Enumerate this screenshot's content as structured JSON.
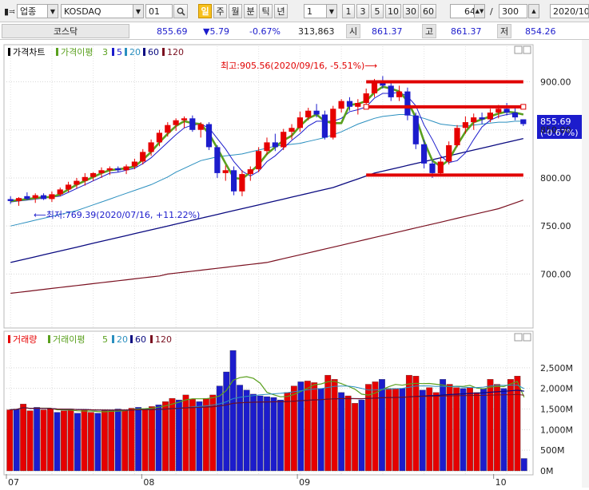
{
  "toolbar": {
    "category": "업종",
    "symbol": "KOSDAQ",
    "period_value": "01",
    "period_buttons": [
      "일",
      "주",
      "월",
      "분",
      "틱",
      "년"
    ],
    "active_period": "일",
    "minute_select": "1",
    "minute_buttons": [
      "1",
      "3",
      "5",
      "10",
      "30",
      "60"
    ],
    "count_value": "64",
    "count_separator": "/",
    "total_value": "300",
    "date_value": "2020/10/"
  },
  "info": {
    "name": "코스닥",
    "price": "855.69",
    "change": "▼5.79",
    "change_pct": "-0.67%",
    "volume": "313,863",
    "open_label": "시",
    "open": "861.37",
    "high_label": "고",
    "high": "861.37",
    "low_label": "저",
    "low": "854.26"
  },
  "colors": {
    "up": "#e60000",
    "down": "#1c1ccc",
    "ma3": "#5aa01e",
    "ma5": "#1c1ccc",
    "ma20": "#2a8fbf",
    "ma60": "#0a0a80",
    "ma120": "#7a1020",
    "highlight": "#e00000"
  },
  "price_panel": {
    "legend_title": "가격차트",
    "legend_ma_label": "가격이평",
    "legend_periods": [
      "3",
      "5",
      "20",
      "60",
      "120"
    ],
    "high_annotation": "최고:905.56(2020/09/16, -5.51%)⟶",
    "low_annotation": "⟵최저:769.39(2020/07/16, +11.22%)",
    "last_price": "855.69",
    "last_change": "(-0.67%)"
  },
  "volume_panel": {
    "legend_title": "거래량",
    "legend_ma_label": "거래이평",
    "legend_periods": [
      "5",
      "20",
      "60",
      "120"
    ]
  },
  "x_axis_labels": [
    "07",
    "08",
    "09",
    "10"
  ],
  "chart_data": {
    "type": "candlestick",
    "price_axis": {
      "ticks": [
        900,
        850,
        800,
        750,
        700
      ],
      "labels": [
        "900.00",
        "850.00",
        "800.00",
        "750.00",
        "700.00"
      ],
      "range": [
        648,
        932
      ]
    },
    "volume_axis": {
      "ticks": [
        2500,
        2000,
        1500,
        1000,
        500,
        0
      ],
      "labels": [
        "2,500M",
        "2,000M",
        "1,500M",
        "1,000M",
        "500M",
        "0M"
      ],
      "range": [
        0,
        3000
      ]
    },
    "candles": [
      {
        "o": 778,
        "h": 781,
        "l": 773,
        "c": 776
      },
      {
        "o": 776,
        "h": 780,
        "l": 771,
        "c": 779
      },
      {
        "o": 781,
        "h": 785,
        "l": 777,
        "c": 778
      },
      {
        "o": 779,
        "h": 784,
        "l": 774,
        "c": 782
      },
      {
        "o": 782,
        "h": 784,
        "l": 777,
        "c": 778
      },
      {
        "o": 778,
        "h": 786,
        "l": 775,
        "c": 783
      },
      {
        "o": 783,
        "h": 790,
        "l": 781,
        "c": 788
      },
      {
        "o": 788,
        "h": 796,
        "l": 785,
        "c": 793
      },
      {
        "o": 793,
        "h": 800,
        "l": 789,
        "c": 797
      },
      {
        "o": 797,
        "h": 805,
        "l": 792,
        "c": 801
      },
      {
        "o": 801,
        "h": 806,
        "l": 797,
        "c": 805
      },
      {
        "o": 805,
        "h": 811,
        "l": 800,
        "c": 808
      },
      {
        "o": 808,
        "h": 812,
        "l": 803,
        "c": 810
      },
      {
        "o": 810,
        "h": 812,
        "l": 806,
        "c": 808
      },
      {
        "o": 808,
        "h": 814,
        "l": 804,
        "c": 812
      },
      {
        "o": 812,
        "h": 820,
        "l": 809,
        "c": 817
      },
      {
        "o": 817,
        "h": 830,
        "l": 814,
        "c": 827
      },
      {
        "o": 827,
        "h": 840,
        "l": 823,
        "c": 837
      },
      {
        "o": 837,
        "h": 850,
        "l": 833,
        "c": 847
      },
      {
        "o": 847,
        "h": 858,
        "l": 843,
        "c": 855
      },
      {
        "o": 855,
        "h": 862,
        "l": 849,
        "c": 860
      },
      {
        "o": 860,
        "h": 864,
        "l": 852,
        "c": 862
      },
      {
        "o": 862,
        "h": 865,
        "l": 848,
        "c": 850
      },
      {
        "o": 850,
        "h": 858,
        "l": 842,
        "c": 856
      },
      {
        "o": 856,
        "h": 858,
        "l": 829,
        "c": 832
      },
      {
        "o": 832,
        "h": 834,
        "l": 800,
        "c": 805
      },
      {
        "o": 805,
        "h": 813,
        "l": 797,
        "c": 808
      },
      {
        "o": 808,
        "h": 812,
        "l": 782,
        "c": 786
      },
      {
        "o": 786,
        "h": 808,
        "l": 781,
        "c": 804
      },
      {
        "o": 804,
        "h": 812,
        "l": 797,
        "c": 809
      },
      {
        "o": 809,
        "h": 832,
        "l": 806,
        "c": 828
      },
      {
        "o": 828,
        "h": 842,
        "l": 824,
        "c": 837
      },
      {
        "o": 837,
        "h": 846,
        "l": 828,
        "c": 832
      },
      {
        "o": 832,
        "h": 851,
        "l": 829,
        "c": 848
      },
      {
        "o": 848,
        "h": 856,
        "l": 840,
        "c": 852
      },
      {
        "o": 852,
        "h": 869,
        "l": 848,
        "c": 863
      },
      {
        "o": 863,
        "h": 873,
        "l": 860,
        "c": 870
      },
      {
        "o": 870,
        "h": 877,
        "l": 863,
        "c": 866
      },
      {
        "o": 866,
        "h": 870,
        "l": 840,
        "c": 842
      },
      {
        "o": 842,
        "h": 875,
        "l": 840,
        "c": 872
      },
      {
        "o": 872,
        "h": 882,
        "l": 868,
        "c": 880
      },
      {
        "o": 880,
        "h": 884,
        "l": 870,
        "c": 874
      },
      {
        "o": 874,
        "h": 882,
        "l": 866,
        "c": 878
      },
      {
        "o": 878,
        "h": 893,
        "l": 874,
        "c": 888
      },
      {
        "o": 888,
        "h": 903,
        "l": 884,
        "c": 900
      },
      {
        "o": 900,
        "h": 906,
        "l": 893,
        "c": 896
      },
      {
        "o": 896,
        "h": 900,
        "l": 880,
        "c": 884
      },
      {
        "o": 884,
        "h": 896,
        "l": 880,
        "c": 890
      },
      {
        "o": 890,
        "h": 894,
        "l": 860,
        "c": 865
      },
      {
        "o": 865,
        "h": 868,
        "l": 830,
        "c": 835
      },
      {
        "o": 835,
        "h": 840,
        "l": 810,
        "c": 815
      },
      {
        "o": 815,
        "h": 818,
        "l": 800,
        "c": 805
      },
      {
        "o": 805,
        "h": 822,
        "l": 802,
        "c": 817
      },
      {
        "o": 817,
        "h": 838,
        "l": 814,
        "c": 834
      },
      {
        "o": 834,
        "h": 855,
        "l": 832,
        "c": 852
      },
      {
        "o": 852,
        "h": 864,
        "l": 846,
        "c": 858
      },
      {
        "o": 858,
        "h": 867,
        "l": 850,
        "c": 863
      },
      {
        "o": 863,
        "h": 868,
        "l": 856,
        "c": 861
      },
      {
        "o": 861,
        "h": 872,
        "l": 858,
        "c": 868
      },
      {
        "o": 868,
        "h": 876,
        "l": 862,
        "c": 872
      },
      {
        "o": 872,
        "h": 878,
        "l": 865,
        "c": 868
      },
      {
        "o": 868,
        "h": 874,
        "l": 860,
        "c": 863
      },
      {
        "o": 861,
        "h": 861,
        "l": 854,
        "c": 856
      }
    ],
    "ma": {
      "ma3": [
        776,
        777,
        778,
        779,
        780,
        780,
        783,
        788,
        793,
        797,
        801,
        805,
        808,
        809,
        810,
        812,
        819,
        827,
        837,
        846,
        854,
        859,
        857,
        856,
        846,
        831,
        815,
        800,
        799,
        806,
        814,
        825,
        832,
        839,
        844,
        854,
        862,
        866,
        859,
        857,
        857,
        876,
        877,
        880,
        889,
        895,
        893,
        890,
        880,
        863,
        838,
        818,
        812,
        819,
        834,
        848,
        858,
        861,
        864,
        867,
        869,
        868,
        866
      ],
      "ma5": [
        775,
        776,
        777,
        778,
        779,
        780,
        781,
        785,
        789,
        793,
        797,
        801,
        805,
        806,
        808,
        810,
        815,
        821,
        829,
        837,
        845,
        852,
        855,
        856,
        852,
        841,
        830,
        817,
        807,
        802,
        807,
        817,
        823,
        831,
        839,
        846,
        854,
        859,
        859,
        859,
        862,
        869,
        871,
        874,
        883,
        888,
        888,
        889,
        885,
        875,
        855,
        840,
        823,
        816,
        818,
        826,
        840,
        853,
        860,
        864,
        866,
        867,
        866
      ],
      "ma20": [
        750,
        752,
        754,
        756,
        758,
        760,
        762,
        764,
        766,
        769,
        772,
        775,
        778,
        781,
        784,
        787,
        790,
        793,
        797,
        801,
        806,
        810,
        814,
        818,
        820,
        822,
        823,
        824,
        825,
        827,
        829,
        831,
        833,
        834,
        835,
        836,
        838,
        840,
        842,
        845,
        848,
        852,
        856,
        859,
        862,
        864,
        865,
        866,
        866,
        864,
        862,
        859,
        856,
        855,
        854,
        854,
        855,
        856,
        857,
        858,
        858,
        859,
        859
      ],
      "ma60": [
        712,
        714,
        716,
        718,
        720,
        722,
        724,
        726,
        728,
        730,
        732,
        734,
        736,
        738,
        740,
        742,
        744,
        746,
        748,
        750,
        752,
        754,
        756,
        758,
        760,
        762,
        764,
        766,
        768,
        770,
        772,
        774,
        776,
        778,
        780,
        782,
        784,
        786,
        788,
        790,
        793,
        796,
        799,
        802,
        805,
        807,
        809,
        811,
        813,
        815,
        817,
        819,
        821,
        823,
        825,
        827,
        829,
        831,
        833,
        835,
        837,
        839,
        841
      ],
      "ma120": [
        680,
        681,
        682,
        683,
        684,
        685,
        686,
        687,
        688,
        689,
        690,
        691,
        692,
        693,
        694,
        695,
        696,
        697,
        698,
        700,
        701,
        702,
        703,
        704,
        705,
        706,
        707,
        708,
        709,
        710,
        711,
        712,
        714,
        716,
        718,
        720,
        722,
        724,
        726,
        728,
        730,
        732,
        734,
        736,
        738,
        740,
        742,
        744,
        746,
        748,
        750,
        752,
        754,
        756,
        758,
        760,
        762,
        764,
        766,
        768,
        771,
        774,
        777
      ]
    },
    "volume": [
      1480,
      1500,
      1620,
      1460,
      1540,
      1480,
      1500,
      1420,
      1460,
      1500,
      1400,
      1480,
      1420,
      1400,
      1460,
      1460,
      1500,
      1480,
      1520,
      1540,
      1500,
      1560,
      1600,
      1680,
      1760,
      1720,
      1840,
      1740,
      1680,
      1760,
      1840,
      2060,
      2400,
      2920,
      2080,
      1960,
      1860,
      1820,
      1800,
      1780,
      1720,
      1900,
      2060,
      2160,
      2180,
      2140,
      2000,
      2320,
      2220,
      1900,
      1820,
      1640,
      1720,
      2100,
      2160,
      2220,
      2000,
      2000,
      2000,
      2320,
      2300,
      1960,
      2020,
      1900,
      2220,
      2100,
      2020,
      2000,
      2020,
      1900,
      2000,
      2220,
      2100,
      2000,
      2220,
      2300,
      300
    ],
    "x_labels": [
      "07",
      "08",
      "09",
      "10"
    ]
  }
}
